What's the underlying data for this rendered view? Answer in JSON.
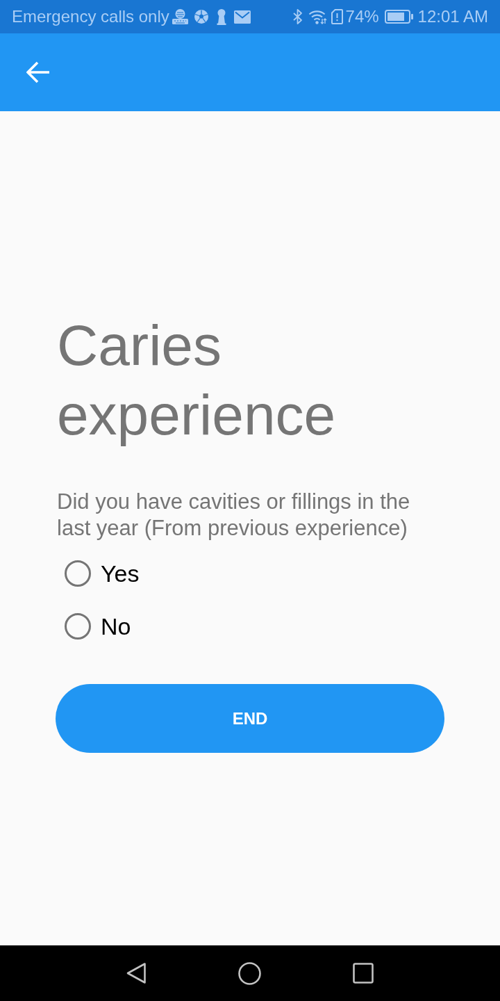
{
  "status_bar": {
    "carrier": "Emergency calls only",
    "battery": "74%",
    "time": "12:01 AM"
  },
  "title": "Caries experience",
  "question": "Did you have cavities or fillings in the last year (From previous experience)",
  "options": [
    {
      "label": "Yes",
      "selected": false
    },
    {
      "label": "No",
      "selected": false
    }
  ],
  "button": "END"
}
